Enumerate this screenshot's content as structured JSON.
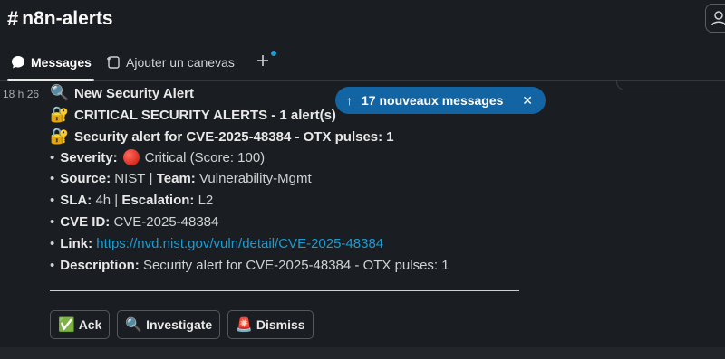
{
  "header": {
    "channel_hash": "#",
    "channel_name": "n8n-alerts"
  },
  "tabs": [
    {
      "label": "Messages",
      "icon": "message-bubble-icon",
      "active": true
    },
    {
      "label": "Ajouter un canevas",
      "icon": "canvas-add-icon",
      "active": false
    }
  ],
  "toast": {
    "arrow": "↑",
    "text": "17 nouveaux messages",
    "close": "✕"
  },
  "message": {
    "timestamp": "18 h 26",
    "title_emoji": "🔍",
    "title": "New Security Alert",
    "critical_emoji": "🔐",
    "critical_line": "CRITICAL SECURITY ALERTS - 1 alert(s)",
    "alert_emoji": "🔐",
    "alert_line": "Security alert for CVE-2025-48384 - OTX pulses: 1",
    "fields": {
      "severity_label": "Severity:",
      "severity_value": "Critical (Score: 100)",
      "source_label": "Source:",
      "source_value": "NIST",
      "separator": "|",
      "team_label": "Team:",
      "team_value": "Vulnerability-Mgmt",
      "sla_label": "SLA:",
      "sla_value": "4h",
      "escalation_label": "Escalation:",
      "escalation_value": "L2",
      "cve_label": "CVE ID:",
      "cve_value": "CVE-2025-48384",
      "link_label": "Link:",
      "link_value": "https://nvd.nist.gov/vuln/detail/CVE-2025-48384",
      "description_label": "Description:",
      "description_value": "Security alert for CVE-2025-48384 - OTX pulses: 1"
    }
  },
  "actions": [
    {
      "emoji": "✅",
      "label": "Ack"
    },
    {
      "emoji": "🔍",
      "label": "Investigate"
    },
    {
      "emoji": "🚨",
      "label": "Dismiss"
    }
  ],
  "colors": {
    "background": "#1a1d21",
    "link": "#1d9bd1",
    "toast": "#1264a3",
    "severity_dot": "#d72b1f"
  }
}
